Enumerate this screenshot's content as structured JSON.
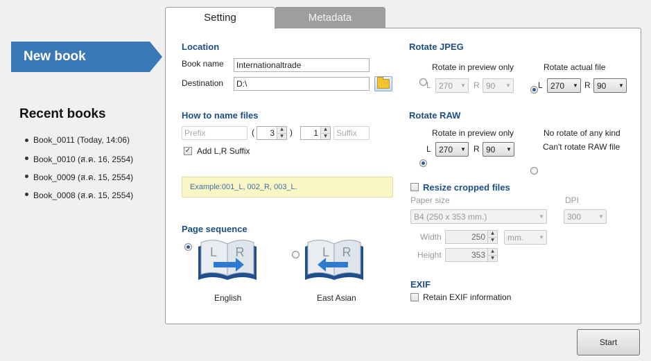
{
  "sidebar": {
    "new_book": "New book",
    "recent_title": "Recent books",
    "recent": [
      "Book_0011 (Today, 14:06)",
      "Book_0010 (ส.ค. 16, 2554)",
      "Book_0009 (ส.ค. 15, 2554)",
      "Book_0008 (ส.ค. 15, 2554)"
    ]
  },
  "tabs": {
    "setting": "Setting",
    "metadata": "Metadata"
  },
  "location": {
    "title": "Location",
    "book_name_label": "Book name",
    "book_name_value": "Internationaltrade",
    "destination_label": "Destination",
    "destination_value": "D:\\"
  },
  "naming": {
    "title": "How to name files",
    "prefix_placeholder": "Prefix",
    "open_paren": "(",
    "close_paren": ")",
    "digits": "3",
    "start": "1",
    "suffix_placeholder": "Suffix",
    "add_lr_label": "Add L,R Suffix",
    "example": "Example:001_L, 002_R, 003_L."
  },
  "page_sequence": {
    "title": "Page sequence",
    "english_label": "English",
    "east_asian_label": "East Asian",
    "book_letters": {
      "left": "L",
      "right": "R"
    }
  },
  "rotate_jpeg": {
    "title": "Rotate JPEG",
    "preview_only": "Rotate in preview only",
    "actual_file": "Rotate actual file",
    "l": "L",
    "r": "R",
    "preview_l": "270",
    "preview_r": "90",
    "actual_l": "270",
    "actual_r": "90"
  },
  "rotate_raw": {
    "title": "Rotate RAW",
    "preview_only": "Rotate in preview only",
    "no_rotate": "No rotate of any kind",
    "cant_rotate": "Can't rotate RAW file",
    "l": "L",
    "r": "R",
    "preview_l": "270",
    "preview_r": "90"
  },
  "resize": {
    "title": "Resize cropped files",
    "paper_size_label": "Paper size",
    "paper_size_value": "B4 (250 x 353 mm.)",
    "dpi_label": "DPI",
    "dpi_value": "300",
    "width_label": "Width",
    "width_value": "250",
    "height_label": "Height",
    "height_value": "353",
    "unit_value": "mm."
  },
  "exif": {
    "title": "EXIF",
    "retain_label": "Retain EXIF information"
  },
  "start_label": "Start",
  "colors": {
    "accent": "#3a78b8",
    "heading": "#1b4e86",
    "example_bg": "#fbf6c5"
  }
}
